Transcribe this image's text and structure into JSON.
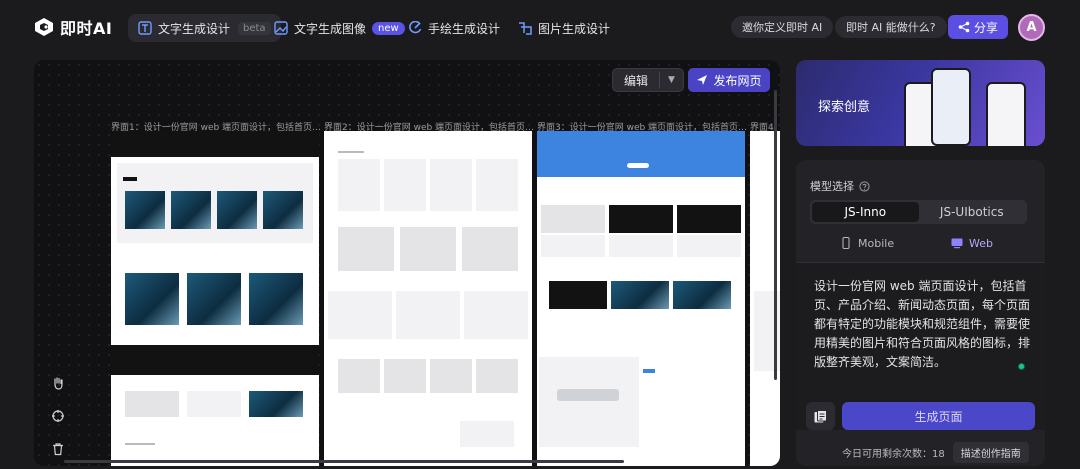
{
  "app": {
    "name": "即时AI"
  },
  "nav": [
    {
      "label": "文字生成设计",
      "tag": "beta",
      "active": true,
      "icon": "text-design-icon"
    },
    {
      "label": "文字生成图像",
      "tag": "new",
      "active": false,
      "icon": "image-icon"
    },
    {
      "label": "手绘生成设计",
      "tag": "",
      "active": false,
      "icon": "sketch-icon"
    },
    {
      "label": "图片生成设计",
      "tag": "",
      "active": false,
      "icon": "image-to-design-icon"
    }
  ],
  "header": {
    "invite_label": "邀你定义即时 AI",
    "what_label": "即时 AI 能做什么?",
    "share_label": "分享",
    "avatar_initial": "A"
  },
  "canvas": {
    "edit_label": "编辑",
    "publish_label": "发布网页",
    "captions": [
      "界面1：设计一份官网 web 端页面设计，包括首页…",
      "界面2：设计一份官网 web 端页面设计，包括首页…",
      "界面3：设计一份官网 web 端页面设计，包括首页…",
      "界面4"
    ]
  },
  "banner": {
    "label": "探索创意"
  },
  "panel": {
    "model_label": "模型选择",
    "models": [
      "JS-Inno",
      "JS-UIbotics"
    ],
    "selected_model": "JS-Inno",
    "devices": [
      "Mobile",
      "Web"
    ],
    "selected_device": "Web",
    "prompt": "设计一份官网 web 端页面设计，包括首页、产品介绍、新闻动态页面，每个页面都有特定的功能模块和规范组件，需要使用精美的图片和符合页面风格的图标，排版整齐美观，文案简洁。",
    "generate_label": "生成页面",
    "quota_text": "今日可用剩余次数：18",
    "guide_label": "描述创作指南"
  },
  "colors": {
    "accent": "#5a4fe2",
    "background": "#1b1b1e",
    "panel": "#232327",
    "status_dot": "#22c08b"
  }
}
